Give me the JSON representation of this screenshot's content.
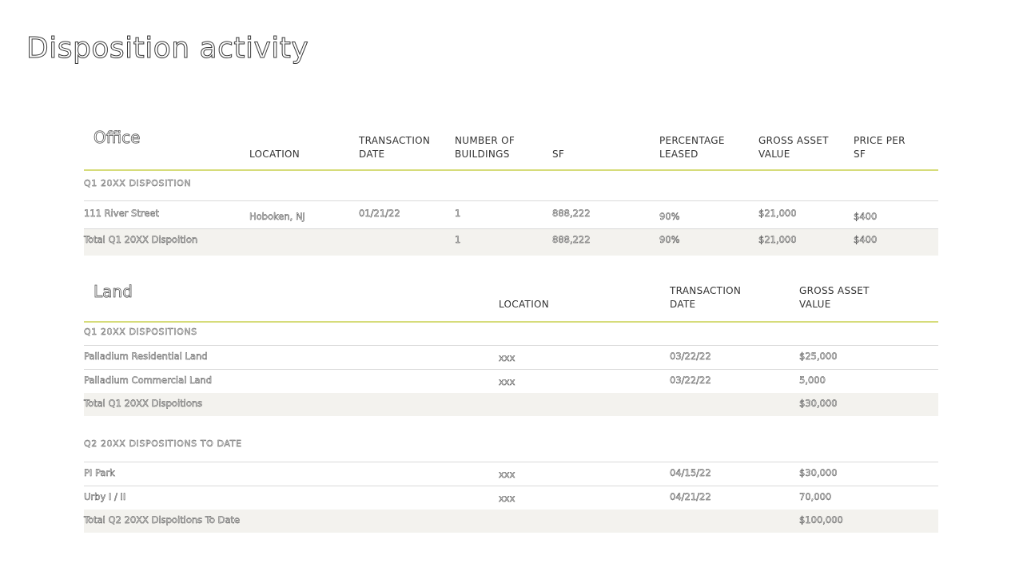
{
  "page_title": "Disposition activity",
  "office": {
    "title": "Office",
    "headers": [
      "LOCATION",
      "TRANSACTION\nDATE",
      "NUMBER OF\nBUILDINGS",
      "SF",
      "PERCENTAGE\nLEASED",
      "GROSS ASSET\nVALUE",
      "PRICE PER\nSF"
    ],
    "group_label": "Q1 20XX DISPOSITION",
    "rows": [
      {
        "name": "111 River Street",
        "location": "Hoboken, NJ",
        "date": "01/21/22",
        "buildings": "1",
        "sf": "888,222",
        "leased": "90%",
        "gav": "$21,000",
        "psf": "$400"
      }
    ],
    "total": {
      "name": "Total Q1 20XX Dispoition",
      "buildings": "1",
      "sf": "888,222",
      "leased": "90%",
      "gav": "$21,000",
      "psf": "$400"
    }
  },
  "land": {
    "title": "Land",
    "headers": [
      "LOCATION",
      "TRANSACTION\nDATE",
      "GROSS ASSET\nVALUE"
    ],
    "groups": [
      {
        "label": "Q1 20XX DISPOSITIONS",
        "rows": [
          {
            "name": "Palladium Residential Land",
            "location": "xxx",
            "date": "03/22/22",
            "gav": "$25,000"
          },
          {
            "name": "Palladium Commercial Land",
            "location": "xxx",
            "date": "03/22/22",
            "gav": "5,000"
          }
        ],
        "total": {
          "name": "Total Q1 20XX Dispoitions",
          "gav": "$30,000"
        }
      },
      {
        "label": "Q2 20XX DISPOSITIONS TO DATE",
        "rows": [
          {
            "name": "PI Park",
            "location": "xxx",
            "date": "04/15/22",
            "gav": "$30,000"
          },
          {
            "name": "Urby I / II",
            "location": "xxx",
            "date": "04/21/22",
            "gav": "70,000"
          }
        ],
        "total": {
          "name": "Total Q2 20XX Dispoitions To Date",
          "gav": "$100,000"
        }
      }
    ]
  }
}
